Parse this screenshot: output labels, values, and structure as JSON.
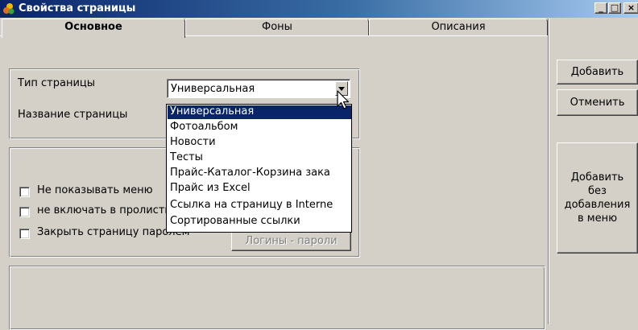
{
  "window": {
    "title": "Свойства страницы",
    "controls": {
      "minimize": "_",
      "maximize": "□",
      "close": "×"
    }
  },
  "tabs": [
    {
      "label": "Основное",
      "active": true
    },
    {
      "label": "Фоны",
      "active": false
    },
    {
      "label": "Описания",
      "active": false
    }
  ],
  "form": {
    "page_type_label": "Тип страницы",
    "page_name_label": "Название страницы",
    "page_type_value": "Универсальная",
    "page_type_options": [
      "Универсальная",
      "Фотоальбом",
      "Новости",
      "Тесты",
      "Прайс-Каталог-Корзина зака",
      "Прайс из Excel",
      "Ссылка на страницу в Interne",
      "Сортированные ссылки"
    ],
    "selected_option_index": 0
  },
  "options": {
    "hide_in_menu": "Не показывать меню",
    "exclude_from_scroll": "не включать в пролистывание",
    "password_protect": "Закрыть страницу паролем",
    "logins_button": "Логины - пароли"
  },
  "side_buttons": {
    "add": "Добавить",
    "cancel": "Отменить",
    "add_without_menu": "Добавить\nбез\nдобавления\nв меню"
  },
  "colors": {
    "title_bar": "#0a246a",
    "selection": "#0a246a",
    "face": "#d4d0c8"
  }
}
